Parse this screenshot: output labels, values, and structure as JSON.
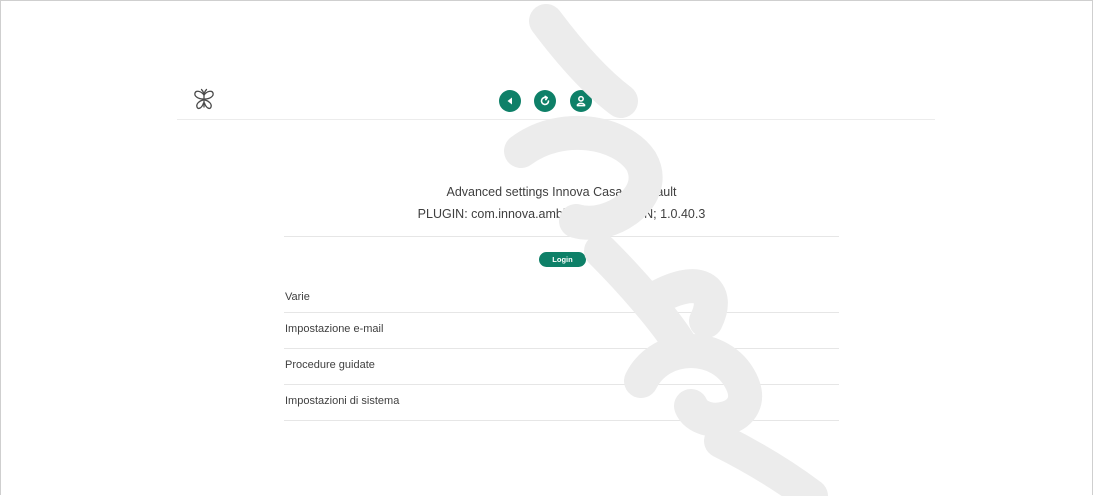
{
  "colors": {
    "accent": "#0e8068",
    "text": "#3f3f3f",
    "divider": "#e6e6e6"
  },
  "header": {
    "logo_icon": "butterfly-logo-icon",
    "buttons": [
      {
        "icon": "back-arrow-icon"
      },
      {
        "icon": "refresh-icon"
      },
      {
        "icon": "user-icon"
      }
    ]
  },
  "main": {
    "title": "Advanced settings Innova Casa di default",
    "subtitle": "PLUGIN: com.innova.ambiente, VERSION; 1.0.40.3",
    "login_label": "Login",
    "menu": [
      {
        "label": "Varie"
      },
      {
        "label": "Impostazione e-mail"
      },
      {
        "label": "Procedure guidate"
      },
      {
        "label": "Impostazioni di sistema"
      }
    ]
  }
}
